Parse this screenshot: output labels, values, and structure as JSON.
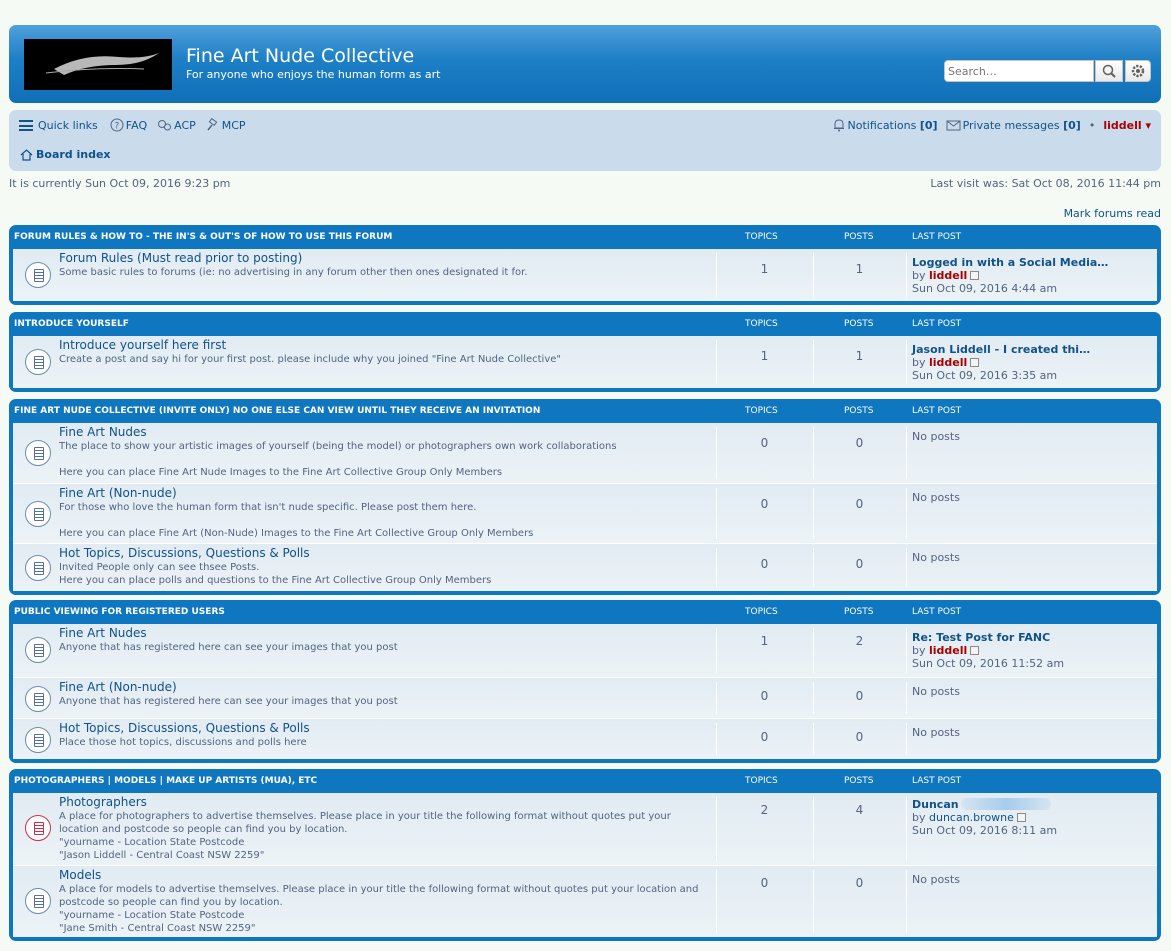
{
  "header": {
    "site_title": "Fine Art Nude Collective",
    "site_desc": "For anyone who enjoys the human form as art",
    "search_placeholder": "Search…",
    "search_icon": "search-icon",
    "advanced_icon": "gear-icon"
  },
  "navbar": {
    "quick_links": "Quick links",
    "faq": "FAQ",
    "acp": "ACP",
    "mcp": "MCP",
    "notifications_label": "Notifications",
    "notifications_count": "[0]",
    "pm_label": "Private messages",
    "pm_count": "[0]",
    "bullet": "•",
    "username": "liddell",
    "dropdown_arrow": "▾",
    "board_index": "Board index"
  },
  "status": {
    "current_time": "It is currently Sun Oct 09, 2016 9:23 pm",
    "last_visit": "Last visit was: Sat Oct 08, 2016 11:44 pm",
    "mark_read": "Mark forums read"
  },
  "columns": {
    "topics": "TOPICS",
    "posts": "POSTS",
    "last_post": "LAST POST"
  },
  "categories": [
    {
      "title": "FORUM RULES & HOW TO - THE IN'S & OUT'S OF HOW TO USE THIS FORUM",
      "forums": [
        {
          "title": "Forum Rules (Must read prior to posting)",
          "desc": "Some basic rules to forums (ie: no advertising in any forum other then ones designated it for.",
          "topics": "1",
          "posts": "1",
          "last_title": "Logged in with a Social Media…",
          "by": "by",
          "last_user": "liddell",
          "last_time": "Sun Oct 09, 2016 4:44 am"
        }
      ]
    },
    {
      "title": "INTRODUCE YOURSELF",
      "forums": [
        {
          "title": "Introduce yourself here first",
          "desc": "Create a post and say hi for your first post. please include why you joined \"Fine Art Nude Collective\"",
          "topics": "1",
          "posts": "1",
          "last_title": "Jason Liddell - I created thi…",
          "by": "by",
          "last_user": "liddell",
          "last_time": "Sun Oct 09, 2016 3:35 am"
        }
      ]
    },
    {
      "title": "FINE ART NUDE COLLECTIVE (INVITE ONLY) NO ONE ELSE CAN VIEW UNTIL THEY RECEIVE AN INVITATION",
      "forums": [
        {
          "title": "Fine Art Nudes",
          "desc": "The place to show your artistic images of yourself (being the model) or photographers own work collaborations\n\nHere you can place Fine Art Nude Images to the Fine Art Collective Group Only Members",
          "topics": "0",
          "posts": "0",
          "no_posts": "No posts"
        },
        {
          "title": "Fine Art (Non-nude)",
          "desc": "For those who love the human form that isn't nude specific. Please post them here.\n\nHere you can place Fine Art (Non-Nude) Images to the Fine Art Collective Group Only Members",
          "topics": "0",
          "posts": "0",
          "no_posts": "No posts"
        },
        {
          "title": "Hot Topics, Discussions, Questions & Polls",
          "desc": "Invited People only can see thsee Posts.\nHere you can place polls and questions to the Fine Art Collective Group Only Members",
          "topics": "0",
          "posts": "0",
          "no_posts": "No posts"
        }
      ]
    },
    {
      "title": "PUBLIC VIEWING FOR REGISTERED USERS",
      "forums": [
        {
          "title": "Fine Art Nudes",
          "desc": "Anyone that has registered here can see your images that you post",
          "topics": "1",
          "posts": "2",
          "last_title": "Re: Test Post for FANC",
          "by": "by",
          "last_user": "liddell",
          "last_time": "Sun Oct 09, 2016 11:52 am"
        },
        {
          "title": "Fine Art (Non-nude)",
          "desc": "Anyone that has registered here can see your images that you post",
          "topics": "0",
          "posts": "0",
          "no_posts": "No posts"
        },
        {
          "title": "Hot Topics, Discussions, Questions & Polls",
          "desc": "Place those hot topics, discussions and polls here",
          "topics": "0",
          "posts": "0",
          "no_posts": "No posts"
        }
      ]
    },
    {
      "title": "PHOTOGRAPHERS | MODELS | MAKE UP ARTISTS (MUA), ETC",
      "forums": [
        {
          "title": "Photographers",
          "desc": "A place for photographers to advertise themselves. Please place in your title the following format without quotes put your location and postcode so people can find you by location.\n\"yourname - Location State Postcode\n\"Jason Liddell - Central Coast NSW 2259\"",
          "topics": "2",
          "posts": "4",
          "last_title": "Duncan",
          "by": "by",
          "last_user": "duncan.browne",
          "last_time": "Sun Oct 09, 2016 8:11 am"
        },
        {
          "title": "Models",
          "desc": "A place for models to advertise themselves. Please place in your title the following format without quotes put your location and postcode so people can find you by location.\n\"yourname - Location State Postcode\n\"Jane Smith - Central Coast NSW 2259\"",
          "topics": "0",
          "posts": "0",
          "no_posts": "No posts"
        }
      ]
    }
  ]
}
